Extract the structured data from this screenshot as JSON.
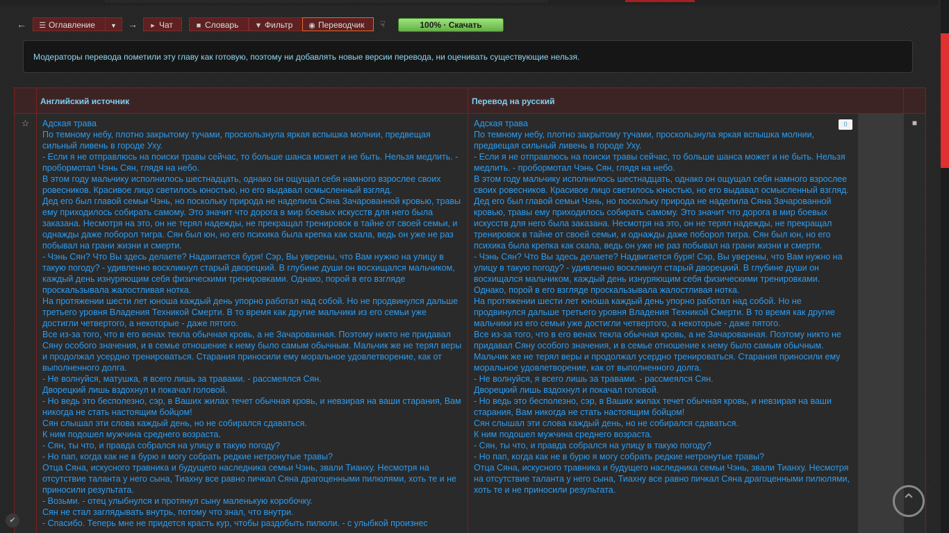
{
  "toolbar": {
    "contents_label": "Оглавление",
    "chat_label": "Чат",
    "dictionary_label": "Словарь",
    "filter_label": "Фильтр",
    "translator_label": "Переводчик",
    "download_label": "100% · Скачать",
    "download_progress": 100
  },
  "notice": "Модераторы перевода пометили эту главу как готовую, поэтому ни добавлять новые версии перевода, ни оценивать существующие нельзя.",
  "table": {
    "col_source": "Английский источник",
    "col_translation": "Перевод на русский",
    "rating": "0"
  },
  "source_lines": [
    "Адская трава",
    "По темному небу, плотно закрытому тучами, проскользнула яркая вспышка молнии, предвещая сильный ливень в городе Уху.",
    "- Если я не отправлюсь на поиски травы сейчас, то больше шанса может и не быть. Нельзя медлить. - пробормотал Чэнь Сян, глядя на небо.",
    "В этом году мальчику исполнилось шестнадцать, однако он ощущал себя намного взрослее своих ровесников. Красивое лицо светилось юностью, но его выдавал осмысленный взгляд.",
    "Дед его был главой семьи Чэнь, но поскольку природа не наделила Сяна Зачарованной кровью, травы ему приходилось собирать самому. Это значит что дорога в мир боевых искусств для него была заказана. Несмотря на это, он не терял надежды, не прекращал тренировок в тайне от своей семьи, и однажды даже поборол тигра. Сян был юн, но его психика была крепка как скала, ведь он уже не раз побывал на грани жизни и смерти.",
    "- Чэнь Сян? Что Вы здесь делаете? Надвигается буря! Сэр, Вы уверены, что Вам нужно на улицу в такую погоду? - удивленно воскликнул старый дворецкий. В глубине души он восхищался мальчиком, каждый день изнуряющим себя физическими тренировками. Однако, порой в его взгляде проскальзывала жалостливая нотка.",
    "На протяжении шести лет юноша каждый день упорно работал над собой. Но не продвинулся дальше третьего уровня Владения Техникой Смерти. В то время как другие мальчики из его семьи уже достигли четвертого, а некоторые - даже пятого.",
    "Все из-за того, что в его венах текла обычная кровь, а не Зачарованная. Поэтому никто не придавал Сяну особого значения, и в семье отношение к нему было самым обычным. Мальчик же не терял веры и продолжал усердно тренироваться. Старания приносили ему моральное удовлетворение, как от выполненного долга.",
    "- Не волнуйся, матушка, я всего лишь за травами. - рассмеялся Сян.",
    "Дворецкий лишь вздохнул и покачал головой.",
    "- Но ведь это бесполезно, сэр, в Ваших жилах течет обычная кровь, и невзирая на ваши старания, Вам никогда не стать настоящим бойцом!",
    "Сян слышал эти слова каждый день, но не собирался сдаваться.",
    "К ним подошел мужчина среднего возраста.",
    "- Сян, ты что, и правда собрался на улицу в такую погоду?",
    "- Но пап, когда как не в бурю я могу собрать редкие нетронутые травы?",
    "Отца Сяна, искусного травника и будущего наследника семьи Чэнь, звали Тианху. Несмотря на отсутствие таланта у него сына, Тиахну все равно пичкал Сяна драгоценными пилюлями, хоть те и не приносили результата.",
    "- Возьми. - отец улыбнулся и протянул сыну маленькую коробочку.",
    "Сян не стал заглядывать внутрь, потому что знал, что внутри.",
    "- Спасибо. Теперь мне не придется красть кур, чтобы раздобыть пилюли. - с улыбкой произнес"
  ],
  "translation_lines": [
    "Адская трава",
    "По темному небу, плотно закрытому тучами, проскользнула яркая вспышка молнии, предвещая сильный ливень в городе Уху.",
    "- Если я не отправлюсь на поиски травы сейчас, то больше шанса может и не быть. Нельзя медлить. - пробормотал Чэнь Сян, глядя на небо.",
    "В этом году мальчику исполнилось шестнадцать, однако он ощущал себя намного взрослее своих ровесников. Красивое лицо светилось юностью, но его выдавал осмысленный взгляд.",
    "Дед его был главой семьи Чэнь, но поскольку природа не наделила Сяна Зачарованной кровью, травы ему приходилось собирать самому. Это значит что дорога в мир боевых искусств для него была заказана. Несмотря на это, он не терял надежды, не прекращал тренировок в тайне от своей семьи, и однажды даже поборол тигра. Сян был юн, но его психика была крепка как скала, ведь он уже не раз побывал на грани жизни и смерти.",
    "- Чэнь Сян? Что Вы здесь делаете? Надвигается буря! Сэр, Вы уверены, что Вам нужно на улицу в такую погоду? - удивленно воскликнул старый дворецкий. В глубине души он восхищался мальчиком, каждый день изнуряющим себя физическими тренировками. Однако, порой в его взгляде проскальзывала жалостливая нотка.",
    "На протяжении шести лет юноша каждый день упорно работал над собой. Но не продвинулся дальше третьего уровня Владения Техникой Смерти. В то время как другие мальчики из его семьи уже достигли четвертого, а некоторые - даже пятого.",
    "Все из-за того, что в его венах текла обычная кровь, а не Зачарованная. Поэтому никто не придавал Сяну особого значения, и в семье отношение к нему было самым обычным. Мальчик же не терял веры и продолжал усердно тренироваться. Старания приносили ему моральное удовлетворение, как от выполненного долга.",
    "- Не волнуйся, я всего лишь за травами. - рассмеялся Сян.",
    "Дворецкий лишь вздохнул и покачал головой.",
    "- Но ведь это бесполезно, сэр, в Ваших жилах течет обычная кровь, и невзирая на ваши старания, Вам никогда не стать настоящим бойцом!",
    "Сян слышал эти слова каждый день, но не собирался сдаваться.",
    "К ним подошел мужчина среднего возраста.",
    "- Сян, ты что, и правда собрался на улицу в такую погоду?",
    "- Но пап, когда как не в бурю я могу собрать редкие нетронутые травы?",
    "Отца Сяна, искусного травника и будущего наследника семьи Чэнь, звали Тианху. Несмотря на отсутствие таланта у него сына, Тиахну все равно пичкал Сяна драгоценными пилюлями, хоть те и не приносили результата."
  ],
  "colors": {
    "accent_red": "#e03030",
    "text_blue": "#2e9cf0",
    "header_blue": "#7fd0f0",
    "download_green": "#6cc445"
  },
  "icons": [
    "arrow-left-icon",
    "list-icon",
    "caret-down-icon",
    "arrow-right-icon",
    "megaphone-icon",
    "book-icon",
    "funnel-icon",
    "eye-icon",
    "thumb-down-icon",
    "star-icon",
    "comment-icon",
    "arrow-up-icon",
    "shield-icon"
  ]
}
